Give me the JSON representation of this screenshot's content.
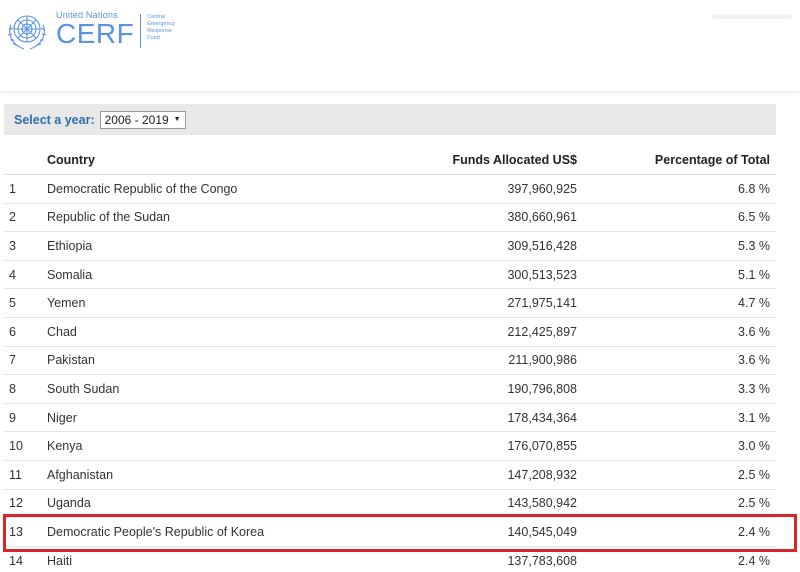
{
  "header": {
    "org_name": "United Nations",
    "logo_text": "CERF",
    "logo_fullname_lines": [
      "Central",
      "Emergency",
      "Response",
      "Fund"
    ]
  },
  "filter": {
    "label": "Select a year:",
    "selected_year": "2006 - 2019"
  },
  "table": {
    "columns": [
      "",
      "Country",
      "Funds Allocated US$",
      "Percentage of Total"
    ],
    "rows": [
      {
        "rank": "1",
        "country": "Democratic Republic of the Congo",
        "funds": "397,960,925",
        "pct": "6.8 %"
      },
      {
        "rank": "2",
        "country": "Republic of the Sudan",
        "funds": "380,660,961",
        "pct": "6.5 %"
      },
      {
        "rank": "3",
        "country": "Ethiopia",
        "funds": "309,516,428",
        "pct": "5.3 %"
      },
      {
        "rank": "4",
        "country": "Somalia",
        "funds": "300,513,523",
        "pct": "5.1 %"
      },
      {
        "rank": "5",
        "country": "Yemen",
        "funds": "271,975,141",
        "pct": "4.7 %"
      },
      {
        "rank": "6",
        "country": "Chad",
        "funds": "212,425,897",
        "pct": "3.6 %"
      },
      {
        "rank": "7",
        "country": "Pakistan",
        "funds": "211,900,986",
        "pct": "3.6 %"
      },
      {
        "rank": "8",
        "country": "South Sudan",
        "funds": "190,796,808",
        "pct": "3.3 %"
      },
      {
        "rank": "9",
        "country": "Niger",
        "funds": "178,434,364",
        "pct": "3.1 %"
      },
      {
        "rank": "10",
        "country": "Kenya",
        "funds": "176,070,855",
        "pct": "3.0 %"
      },
      {
        "rank": "11",
        "country": "Afghanistan",
        "funds": "147,208,932",
        "pct": "2.5 %"
      },
      {
        "rank": "12",
        "country": "Uganda",
        "funds": "143,580,942",
        "pct": "2.5 %"
      },
      {
        "rank": "13",
        "country": "Democratic People's Republic of Korea",
        "funds": "140,545,049",
        "pct": "2.4 %"
      },
      {
        "rank": "14",
        "country": "Haiti",
        "funds": "137,783,608",
        "pct": "2.4 %"
      }
    ],
    "highlighted_rank": "13"
  },
  "colors": {
    "brand_blue": "#5b92e5",
    "label_blue": "#2e6fad",
    "highlight_red": "#d9262a"
  }
}
